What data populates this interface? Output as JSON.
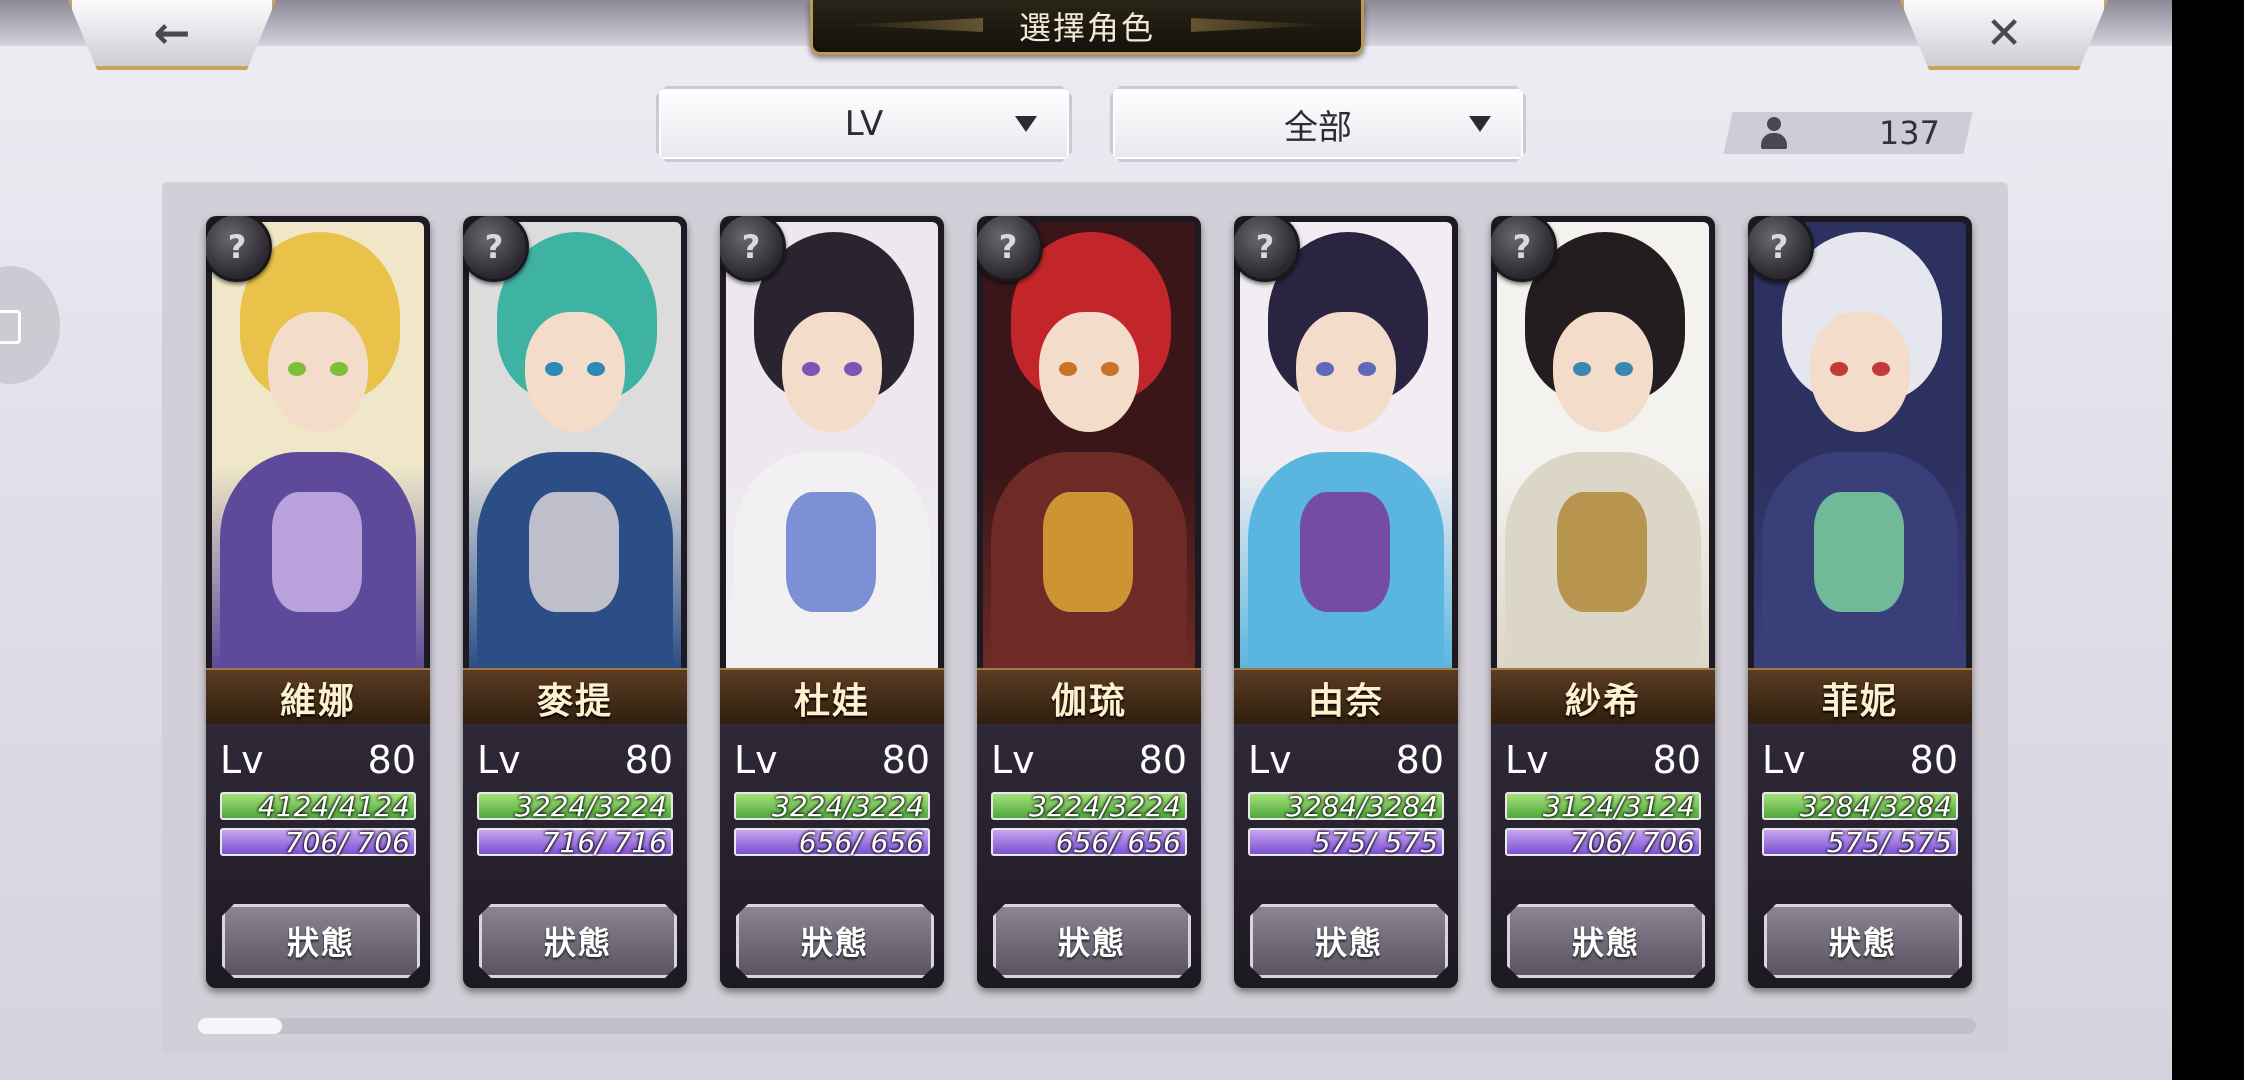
{
  "header": {
    "title": "選擇角色",
    "back_icon": "←",
    "close_icon": "✕"
  },
  "filters": {
    "sort_value": "LV",
    "category_value": "全部"
  },
  "count": {
    "value": "137"
  },
  "characters": [
    {
      "name": "維娜",
      "lv_label": "Lv",
      "level": "80",
      "hp": "4124/4124",
      "mp": "706/ 706",
      "status_label": "狀態",
      "hair": "#e9c24a",
      "eye": "#7bbf3a",
      "outfit": "#5d4a9a",
      "accent": "#c9b2e8",
      "bg": "#efe7c8"
    },
    {
      "name": "麥提",
      "lv_label": "Lv",
      "level": "80",
      "hp": "3224/3224",
      "mp": "716/ 716",
      "status_label": "狀態",
      "hair": "#3fb3a2",
      "eye": "#2d89b7",
      "outfit": "#2b4e86",
      "accent": "#d8d4d6",
      "bg": "#dcdcdc"
    },
    {
      "name": "杜娃",
      "lv_label": "Lv",
      "level": "80",
      "hp": "3224/3224",
      "mp": "656/ 656",
      "status_label": "狀態",
      "hair": "#2a2430",
      "eye": "#7b56b8",
      "outfit": "#f2f0f2",
      "accent": "#6a7fd0",
      "bg": "#ece8ee"
    },
    {
      "name": "伽琉",
      "lv_label": "Lv",
      "level": "80",
      "hp": "3224/3224",
      "mp": "656/ 656",
      "status_label": "狀態",
      "hair": "#c3262a",
      "eye": "#c8722a",
      "outfit": "#6e2a24",
      "accent": "#e0a63a",
      "bg": "#3a1618"
    },
    {
      "name": "由奈",
      "lv_label": "Lv",
      "level": "80",
      "hp": "3284/3284",
      "mp": "575/ 575",
      "status_label": "狀態",
      "hair": "#2a2440",
      "eye": "#5b6bb8",
      "outfit": "#5ab6df",
      "accent": "#7a3a9a",
      "bg": "#f1edf2"
    },
    {
      "name": "紗希",
      "lv_label": "Lv",
      "level": "80",
      "hp": "3124/3124",
      "mp": "706/ 706",
      "status_label": "狀態",
      "hair": "#231d1f",
      "eye": "#3a88b0",
      "outfit": "#dcd6c6",
      "accent": "#b28a3a",
      "bg": "#f4f2ef"
    },
    {
      "name": "菲妮",
      "lv_label": "Lv",
      "level": "80",
      "hp": "3284/3284",
      "mp": "575/ 575",
      "status_label": "狀態",
      "hair": "#e6e6ee",
      "eye": "#c23a3a",
      "outfit": "#3a3f7a",
      "accent": "#7ad0a0",
      "bg": "#2c3160"
    }
  ],
  "scroll": {
    "position": 0
  },
  "icons": {
    "lock_badge": "question-mark-badge-icon",
    "count_icon": "person-icon"
  }
}
